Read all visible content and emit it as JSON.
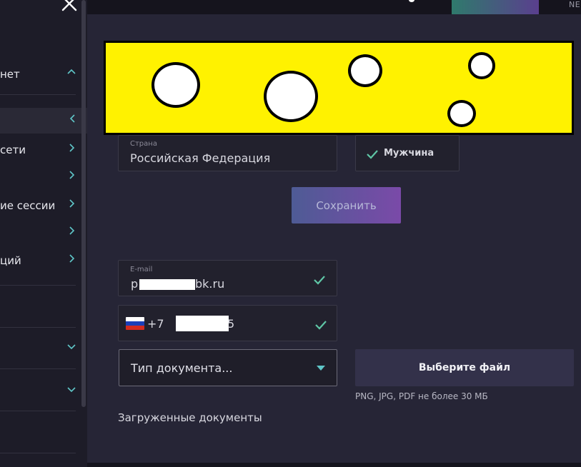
{
  "sidebar": {
    "items": [
      {
        "label": "нет",
        "chevron": "up"
      },
      {
        "label": "",
        "chevron": "left",
        "active": true
      },
      {
        "label": "сети",
        "chevron": "right"
      },
      {
        "label": "",
        "chevron": "right"
      },
      {
        "label": "ие сессии",
        "chevron": "right"
      },
      {
        "label": "",
        "chevron": "right"
      },
      {
        "label": "ций",
        "chevron": "right"
      },
      {
        "label": "",
        "chevron": "down"
      },
      {
        "label": "",
        "chevron": "down"
      }
    ]
  },
  "topbar": {
    "corner_text": "NE"
  },
  "form": {
    "country": {
      "label": "Страна",
      "value": "Российская Федерация"
    },
    "gender": {
      "value": "Мужчина"
    },
    "save_label": "Сохранить",
    "email": {
      "label": "E-mail",
      "value_start": "p",
      "value_end": "bk.ru"
    },
    "phone": {
      "code": "+7",
      "tail": "5"
    },
    "doc_type": {
      "placeholder": "Тип документа..."
    },
    "file_button_label": "Выберите файл",
    "file_hint": "PNG, JPG, PDF не более 30 МБ",
    "uploaded_title": "Загруженные документы"
  },
  "colors": {
    "accent_check": "#5fc6a6",
    "select_arrow": "#5fc6c8",
    "banner": "#fff200"
  }
}
